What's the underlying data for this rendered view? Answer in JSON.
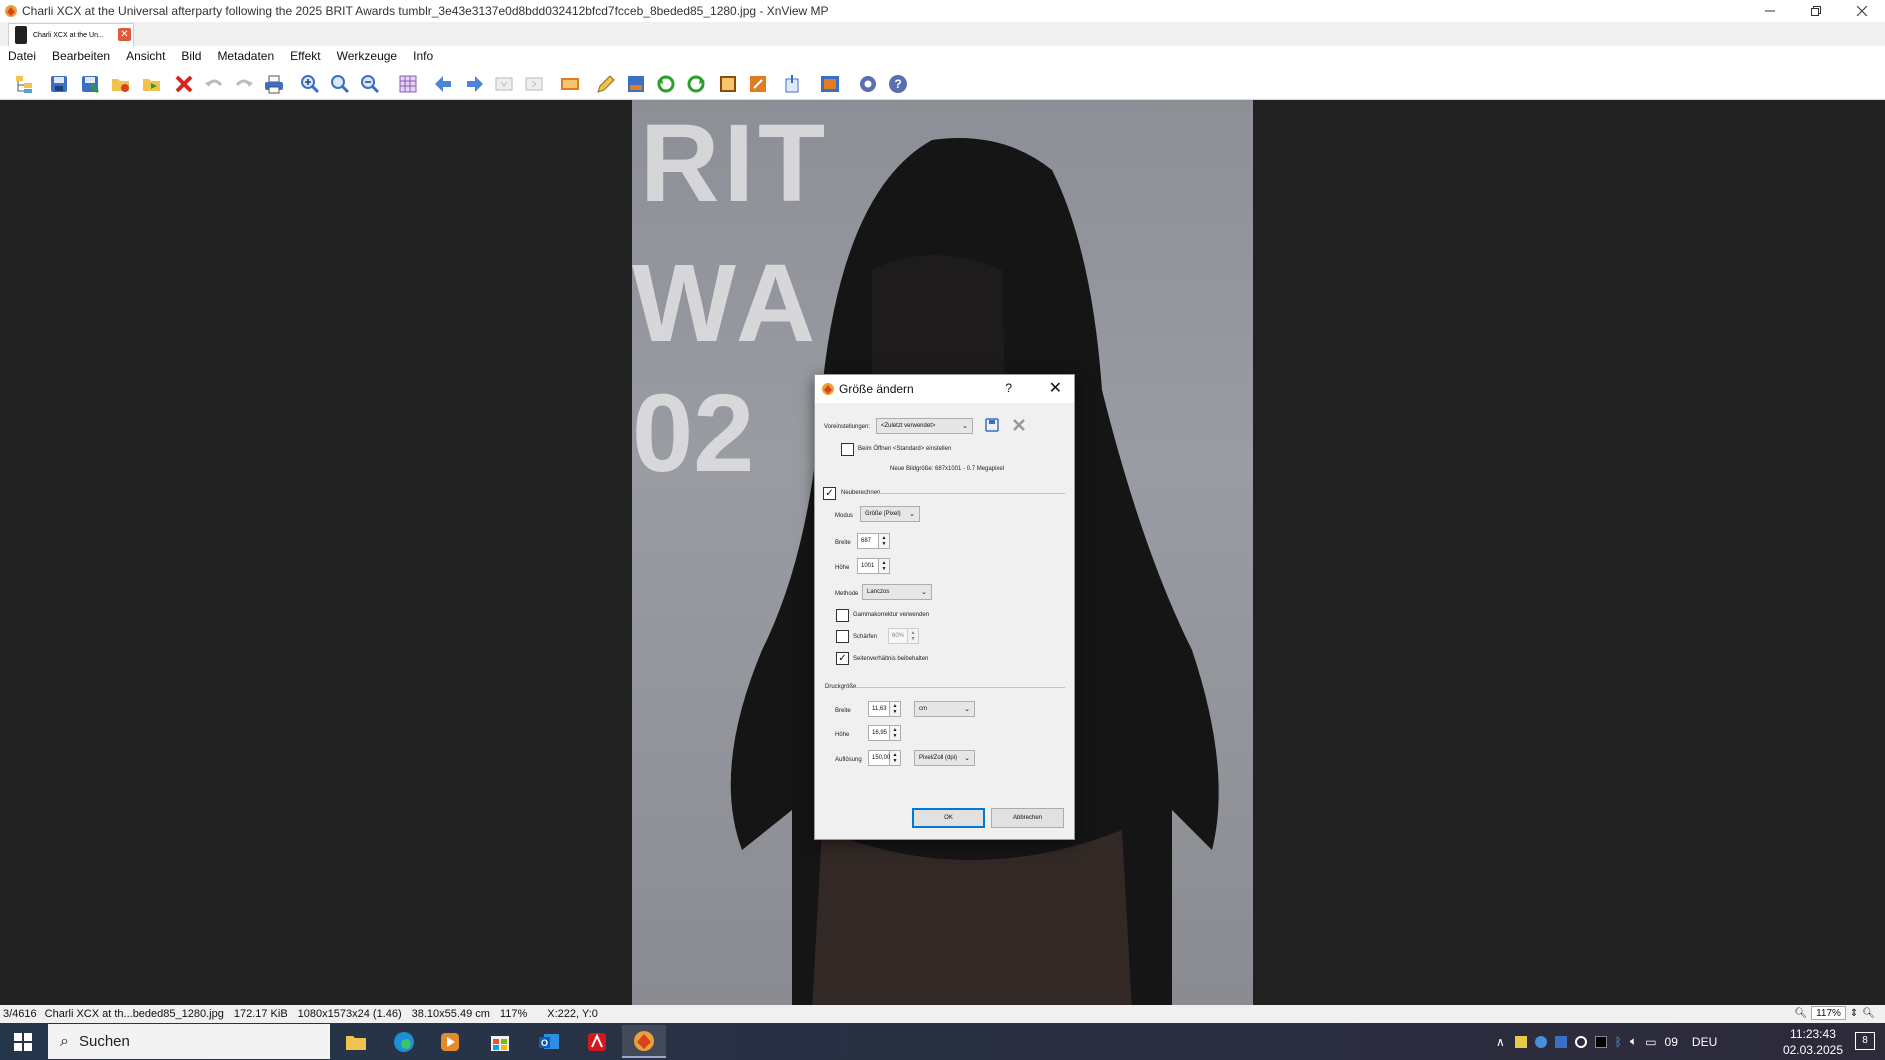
{
  "window": {
    "title": "Charli XCX at the Universal afterparty following the 2025 BRIT Awards tumblr_3e43e3137e0d8bdd032412bfcd7fcceb_8beded85_1280.jpg - XnView MP"
  },
  "tab": {
    "label": "Charli XCX at the Un..."
  },
  "menu": [
    "Datei",
    "Bearbeiten",
    "Ansicht",
    "Bild",
    "Metadaten",
    "Effekt",
    "Werkzeuge",
    "Info"
  ],
  "photo_text": [
    "RIT",
    "WA  DS",
    "02"
  ],
  "dialog": {
    "title": "Größe ändern",
    "help": "?",
    "close": "✕",
    "presets_label": "Voreinstellungen:",
    "presets_value": "<Zuletzt verwendet>",
    "open_default_label": "Beim Öffnen <Standard> einstellen",
    "new_size": "Neue Bildgröße: 687x1001 - 0.7 Megapixel",
    "recalc_label": "Neuberechnen",
    "mode_label": "Modus",
    "mode_value": "Größe (Pixel)",
    "width_label": "Breite",
    "width_value": "687",
    "height_label": "Höhe",
    "height_value": "1001",
    "method_label": "Methode",
    "method_value": "Lanczos",
    "gamma_label": "Gammakorrektur verwenden",
    "sharpen_label": "Schärfen",
    "sharpen_value": "60%",
    "keep_ratio_label": "Seitenverhältnis beibehalten",
    "print_size_label": "Druckgröße",
    "print_width_label": "Breite",
    "print_width_value": "11,63",
    "print_width_unit": "cm",
    "print_height_label": "Höhe",
    "print_height_value": "16,95",
    "resolution_label": "Auflösung",
    "resolution_value": "150,00",
    "resolution_unit": "Pixel/Zoll (dpi)",
    "ok_label": "OK",
    "cancel_label": "Abbrechen"
  },
  "status": {
    "index": "3/4616",
    "file": "Charli XCX at th...beded85_1280.jpg",
    "size": "172.17 KiB",
    "dims": "1080x1573x24 (1.46)",
    "print": "38.10x55.49 cm",
    "zoom": "117%",
    "coords": "X:222, Y:0",
    "zoom_box": "117%"
  },
  "taskbar": {
    "search_placeholder": "Suchen",
    "tray_number": "09",
    "lang": "DEU",
    "time": "11:23:43",
    "date": "02.03.2025",
    "notifications": "8"
  }
}
